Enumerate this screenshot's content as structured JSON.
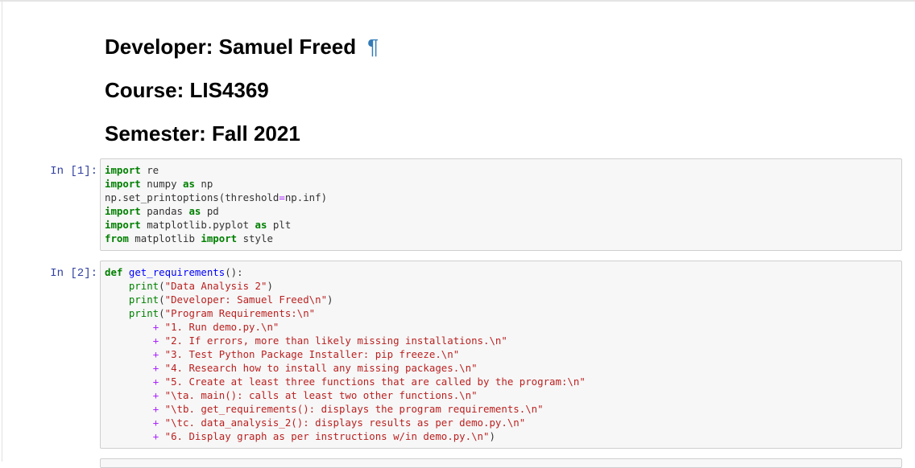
{
  "markdown": {
    "developer": "Developer: Samuel Freed",
    "pilcrow": "¶",
    "course": "Course: LIS4369",
    "semester": "Semester: Fall 2021"
  },
  "cells": [
    {
      "prompt": "In [1]:",
      "lines": [
        "import re",
        "import numpy as np",
        "np.set_printoptions(threshold=np.inf)",
        "import pandas as pd",
        "import matplotlib.pyplot as plt",
        "from matplotlib import style"
      ]
    },
    {
      "prompt": "In [2]:",
      "lines": [
        "def get_requirements():",
        "    print(\"Data Analysis 2\")",
        "    print(\"Developer: Samuel Freed\\n\")",
        "    print(\"Program Requirements:\\n\"",
        "        + \"1. Run demo.py.\\n\"",
        "        + \"2. If errors, more than likely missing installations.\\n\"",
        "        + \"3. Test Python Package Installer: pip freeze.\\n\"",
        "        + \"4. Research how to install any missing packages.\\n\"",
        "        + \"5. Create at least three functions that are called by the program:\\n\"",
        "        + \"\\ta. main(): calls at least two other functions.\\n\"",
        "        + \"\\tb. get_requirements(): displays the program requirements.\\n\"",
        "        + \"\\tc. data_analysis_2(): displays results as per demo.py.\\n\"",
        "        + \"6. Display graph as per instructions w/in demo.py.\\n\")"
      ]
    }
  ]
}
